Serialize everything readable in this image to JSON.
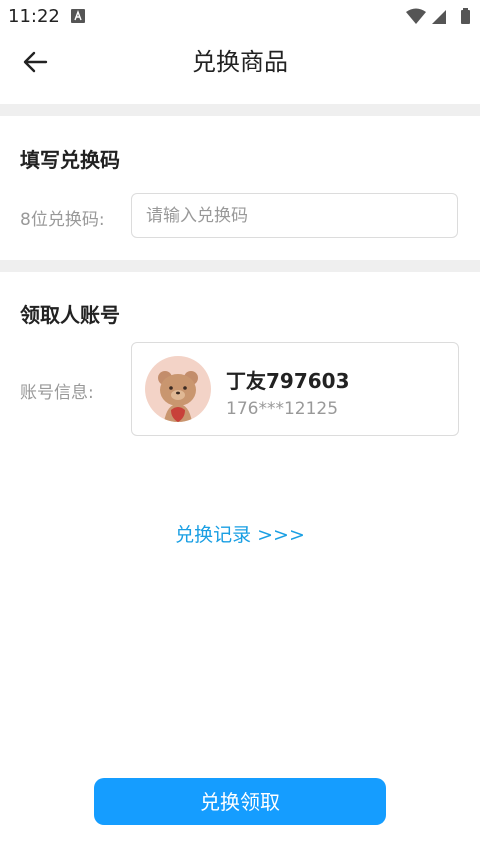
{
  "status_bar": {
    "time": "11:22"
  },
  "header": {
    "title": "兑换商品"
  },
  "code_section": {
    "title": "填写兑换码",
    "label": "8位兑换码:",
    "input_value": "",
    "input_placeholder": "请输入兑换码"
  },
  "account_section": {
    "title": "领取人账号",
    "label": "账号信息:",
    "name": "丁友797603",
    "phone": "176***12125"
  },
  "history_link": "兑换记录 >>>",
  "redeem_button": "兑换领取",
  "colors": {
    "accent": "#159dff",
    "link": "#1a9fe3",
    "divider": "#efefef"
  }
}
